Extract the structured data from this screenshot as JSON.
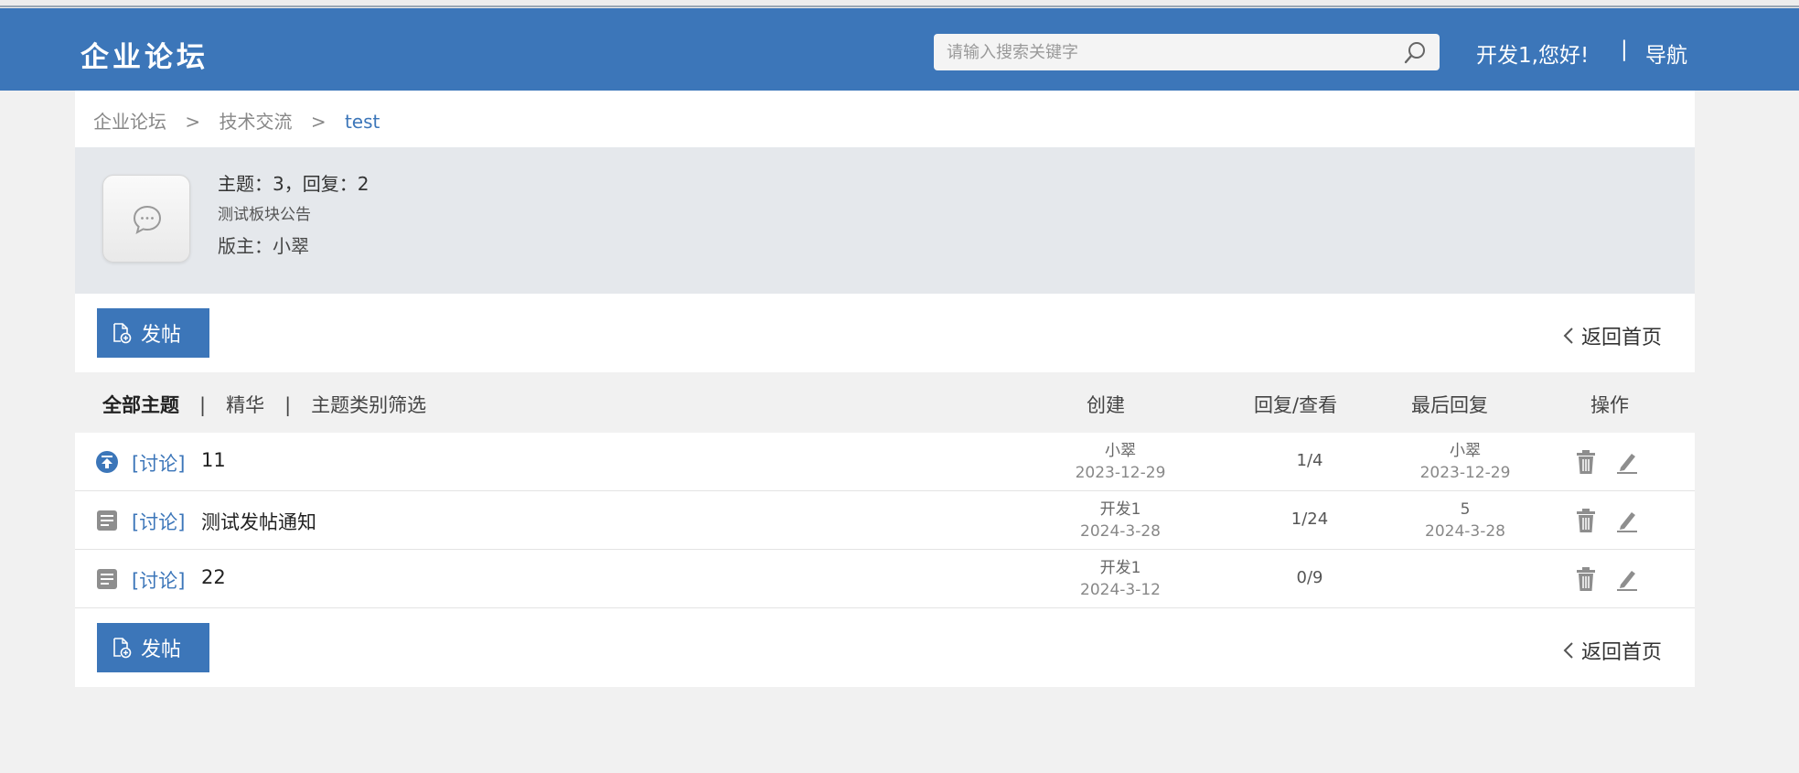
{
  "header": {
    "logo": "企业论坛",
    "search_placeholder": "请输入搜索关键字",
    "greeting": "开发1,您好!",
    "separator": "|",
    "nav_label": "导航"
  },
  "breadcrumb": {
    "items": [
      "企业论坛",
      ">",
      "技术交流",
      ">"
    ],
    "current": "test"
  },
  "board": {
    "stats": "主题：3，回复：2",
    "notice": "测试板块公告",
    "moderator": "版主：小翠"
  },
  "actions": {
    "post_label": "发帖",
    "home_label": "返回首页"
  },
  "filters": {
    "all": "全部主题",
    "sep": "|",
    "digest": "精华",
    "category": "主题类别筛选"
  },
  "columns": {
    "created": "创建",
    "replies_views": "回复/查看",
    "last_reply": "最后回复",
    "operations": "操作"
  },
  "threads": [
    {
      "icon": "pinned-up-icon",
      "tag": "[讨论]",
      "title": "11",
      "author": "小翠",
      "created": "2023-12-29",
      "replies_views": "1/4",
      "last_user": "小翠",
      "last_date": "2023-12-29"
    },
    {
      "icon": "document-icon",
      "tag": "[讨论]",
      "title": "测试发帖通知",
      "author": "开发1",
      "created": "2024-3-28",
      "replies_views": "1/24",
      "last_user": "5",
      "last_date": "2024-3-28"
    },
    {
      "icon": "document-icon",
      "tag": "[讨论]",
      "title": "22",
      "author": "开发1",
      "created": "2024-3-12",
      "replies_views": "0/9",
      "last_user": "",
      "last_date": ""
    }
  ],
  "colors": {
    "brand": "#3c76b9",
    "page_bg": "#f1f1f1",
    "info_bg": "#e5e8ec"
  }
}
